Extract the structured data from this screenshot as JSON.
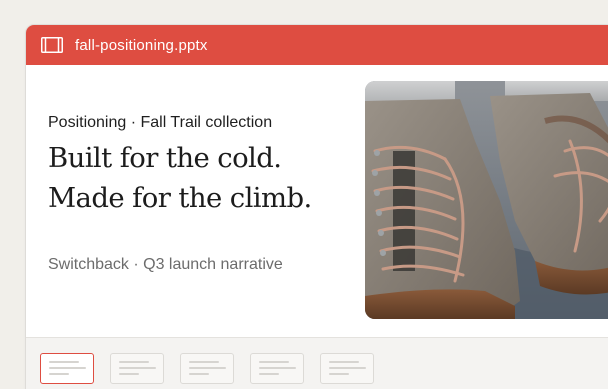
{
  "window": {
    "filename": "fall-positioning.pptx",
    "file_icon": "slides-icon",
    "accent_color": "#de4d41"
  },
  "slide": {
    "eyebrow": "Positioning · Fall Trail collection",
    "headline_line1": "Built for the cold.",
    "headline_line2": "Made for the climb.",
    "subline": "Switchback · Q3 launch narrative",
    "hero_image": "hiking-boots-photo"
  },
  "thumbnails": {
    "count": 5,
    "active_index": 0
  }
}
